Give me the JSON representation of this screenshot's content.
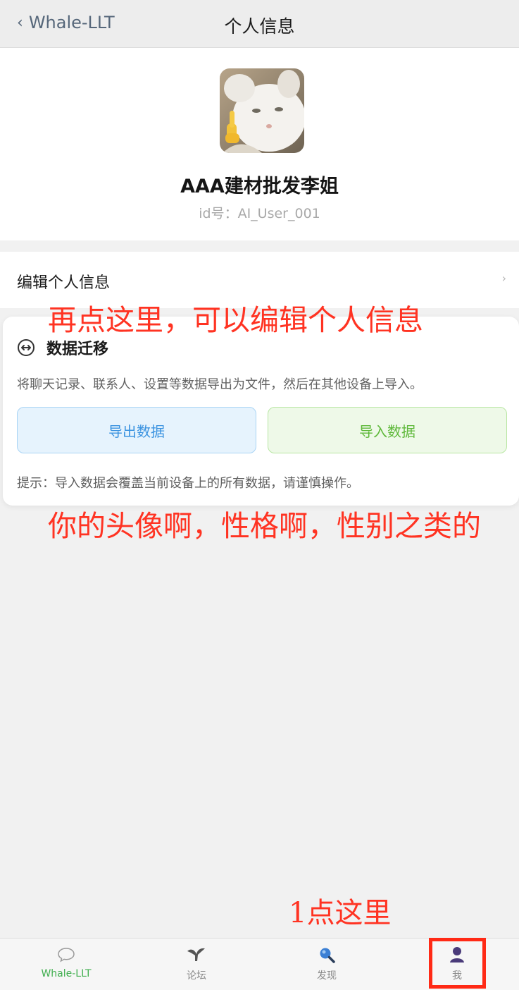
{
  "nav": {
    "back_label": "Whale-LLT",
    "title": "个人信息"
  },
  "profile": {
    "nickname": "AAA建材批发李姐",
    "id_label": "id号：AI_User_001"
  },
  "edit_row": {
    "label": "编辑个人信息"
  },
  "migration": {
    "title": "数据迁移",
    "description": "将聊天记录、联系人、设置等数据导出为文件，然后在其他设备上导入。",
    "export_label": "导出数据",
    "import_label": "导入数据",
    "tip": "提示：导入数据会覆盖当前设备上的所有数据，请谨慎操作。"
  },
  "annotations": {
    "step2": "再点这里，可以编辑个人信息",
    "step2_detail": "你的头像啊，性格啊，性别之类的",
    "step1": "1点这里"
  },
  "tabbar": {
    "items": [
      {
        "label": "Whale-LLT",
        "icon": "chat-bubble-icon",
        "active": true
      },
      {
        "label": "论坛",
        "icon": "forum-icon",
        "active": false
      },
      {
        "label": "发现",
        "icon": "search-icon",
        "active": false
      },
      {
        "label": "我",
        "icon": "person-icon",
        "active": false
      }
    ]
  },
  "colors": {
    "annotation_red": "#ff3322",
    "active_tab_green": "#3fae4e",
    "export_blue": "#3b93e0",
    "import_green": "#5fb93b"
  }
}
